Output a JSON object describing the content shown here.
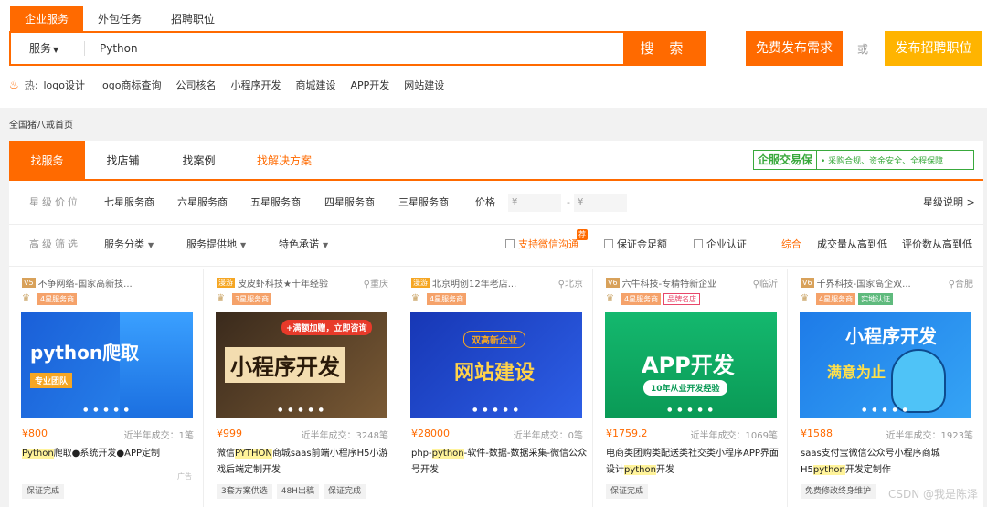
{
  "search_tabs": [
    "企业服务",
    "外包任务",
    "招聘职位"
  ],
  "search": {
    "category": "服务",
    "value": "Python",
    "button": "搜 索"
  },
  "post_free_label": "免费发布需求",
  "or_label": "或",
  "post_job_label": "发布招聘职位",
  "hot": {
    "label": "热:",
    "keywords": [
      "logo设计",
      "logo商标查询",
      "公司核名",
      "小程序开发",
      "商城建设",
      "APP开发",
      "网站建设"
    ]
  },
  "breadcrumb": "全国猪八戒首页",
  "panel_tabs": [
    "找服务",
    "找店铺",
    "找案例",
    "找解决方案"
  ],
  "guarantee": {
    "logo": "企服交易保",
    "text": "• 采购合规、资金安全、全程保障"
  },
  "filter_star": {
    "label": "星级价位",
    "levels": [
      "七星服务商",
      "六星服务商",
      "五星服务商",
      "四星服务商",
      "三星服务商"
    ],
    "price_label": "价格",
    "price_ph": "¥",
    "dash": "-",
    "star_help": "星级说明 >"
  },
  "filter_adv": {
    "label": "高级筛选",
    "dropdowns": [
      "服务分类",
      "服务提供地",
      "特色承诺"
    ],
    "checks": [
      "支持微信沟通",
      "保证金足额",
      "企业认证"
    ],
    "hot_tag": "荐",
    "sorts": [
      "综合",
      "成交量从高到低",
      "评价数从高到低"
    ]
  },
  "cards": [
    {
      "shop": "不争网络-国家高新技...",
      "vt": "V5",
      "loc": "",
      "badges": [
        "4星服务商"
      ],
      "img_text": "python爬取",
      "img_sub": "专业团队",
      "price": "¥800",
      "sold": "近半年成交：1笔",
      "title_pre": "",
      "title_hl": "Python",
      "title_post": "爬取●系统开发●APP定制",
      "ad": "广告",
      "tags": [
        "保证完成"
      ]
    },
    {
      "shop": "皮皮虾科技★十年经验",
      "vt": "漫游",
      "loc": "重庆",
      "badges": [
        "3星服务商"
      ],
      "img_text": "小程序开发",
      "img_sub": "+满额加赠，立即咨询",
      "price": "¥999",
      "sold": "近半年成交：3248笔",
      "title_pre": "微信",
      "title_hl": "PYTHON",
      "title_post": "商城saas前端小程序H5小游戏后端定制开发",
      "ad": "",
      "tags": [
        "3套方案供选",
        "48H出稿",
        "保证完成"
      ]
    },
    {
      "shop": "北京明创12年老店...",
      "vt": "漫游",
      "loc": "北京",
      "badges": [
        "4星服务商"
      ],
      "img_text": "网站建设",
      "img_sub": "双高新企业",
      "price": "¥28000",
      "sold": "近半年成交：0笔",
      "title_pre": "php-",
      "title_hl": "python",
      "title_post": "-软件-数据-数据采集-微信公众号开发",
      "ad": "",
      "tags": []
    },
    {
      "shop": "六牛科技-专精特新企业",
      "vt": "V6",
      "loc": "临沂",
      "badges": [
        "4星服务商",
        "品牌名店"
      ],
      "img_text": "APP开发",
      "img_sub": "10年从业开发经验",
      "price": "¥1759.2",
      "sold": "近半年成交：1069笔",
      "title_pre": "电商类团购类配送类社交类小程序APP界面设计",
      "title_hl": "python",
      "title_post": "开发",
      "ad": "",
      "tags": [
        "保证完成"
      ]
    },
    {
      "shop": "千界科技-国家高企双...",
      "vt": "V6",
      "loc": "合肥",
      "badges": [
        "4星服务商",
        "实地认证"
      ],
      "img_text": "小程序开发",
      "img_sub": "满意为止",
      "price": "¥1588",
      "sold": "近半年成交：1923笔",
      "title_pre": "saas支付宝微信公众号小程序商城H5",
      "title_hl": "python",
      "title_post": "开发定制作",
      "ad": "",
      "tags": [
        "免费修改终身维护"
      ]
    }
  ],
  "watermark": "CSDN @我是陈泽"
}
